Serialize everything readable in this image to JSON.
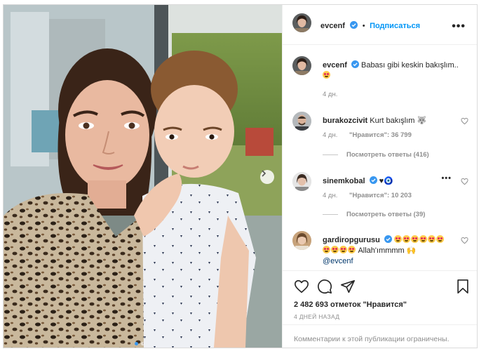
{
  "header": {
    "username": "evcenf",
    "follow_label": "Подписаться",
    "more_label": "•••"
  },
  "caption": {
    "username": "evcenf",
    "text": "Babası gibi keskin bakışlım..",
    "time": "4 дн."
  },
  "comments": [
    {
      "username": "burakozcivit",
      "text": "Kurt bakışlım 🐺",
      "time": "4 дн.",
      "likes": "\"Нравится\": 36 799",
      "replies": "Посмотреть ответы (416)"
    },
    {
      "username": "sinemkobal",
      "text": "♥🧿",
      "time": "4 дн.",
      "likes": "\"Нравится\": 10 203",
      "more_label": "•••",
      "replies": "Посмотреть ответы (39)"
    },
    {
      "username": "gardiropgurusu",
      "text": "Allah'ımmmm 🙌",
      "mention": "@evcenf"
    }
  ],
  "footer": {
    "likes_count": "2 482 693 отметок \"Нравится\"",
    "date": "4 ДНЕЙ НАЗАД",
    "restricted": "Комментарии к этой публикации ограничены."
  },
  "colors": {
    "accent": "#0095f6",
    "verified": "#3897f0",
    "muted": "#8e8e8e",
    "text": "#262626"
  },
  "icons": {
    "like": "heart-icon",
    "comment": "comment-icon",
    "share": "paper-plane-icon",
    "save": "bookmark-icon",
    "next": "chevron-right-icon",
    "verified": "verified-badge-icon"
  }
}
